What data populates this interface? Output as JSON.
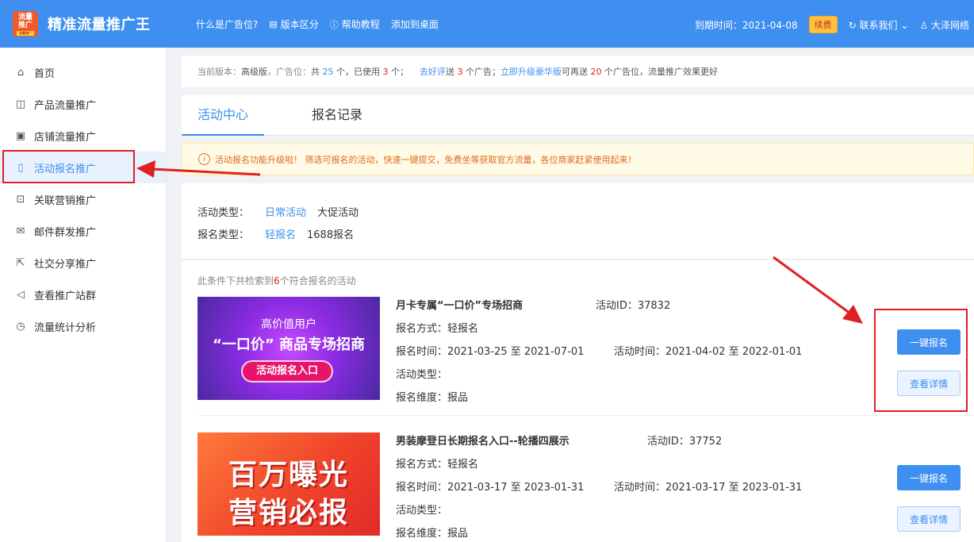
{
  "app": {
    "logo_line1": "流量",
    "logo_line2": "推广",
    "logo_sub": "流量推广",
    "title": "精准流量推广王"
  },
  "topnav": [
    {
      "label": "什么是广告位?",
      "icon": ""
    },
    {
      "label": "版本区分",
      "icon": "document-icon"
    },
    {
      "label": "帮助教程",
      "icon": "help-icon"
    },
    {
      "label": "添加到桌面",
      "icon": ""
    }
  ],
  "header_right": {
    "expire": "到期时间：2021-04-08",
    "renew": "续费",
    "contact": "联系我们",
    "user": "大泽网络"
  },
  "sidebar": [
    {
      "label": "首页",
      "icon": "home-icon"
    },
    {
      "label": "产品流量推广",
      "icon": "bag-icon"
    },
    {
      "label": "店铺流量推广",
      "icon": "store-icon"
    },
    {
      "label": "活动报名推广",
      "icon": "phone-icon"
    },
    {
      "label": "关联营销推广",
      "icon": "chart-icon"
    },
    {
      "label": "邮件群发推广",
      "icon": "mail-icon"
    },
    {
      "label": "社交分享推广",
      "icon": "share-icon"
    },
    {
      "label": "查看推广站群",
      "icon": "megaphone-icon"
    },
    {
      "label": "流量统计分析",
      "icon": "stats-icon"
    }
  ],
  "notice": {
    "p1": "当前版本：",
    "version": "高级版",
    "p2": "，广告位：",
    "p3": "共",
    "total": "25",
    "p4": "个，已使用",
    "used": "3",
    "p5": "个；",
    "review_link": "去好评",
    "p6": "送",
    "review_count": "3",
    "p7": "个广告；",
    "upgrade_link": "立即升级豪华版",
    "p8": "可再送",
    "upgrade_count": "20",
    "p9": "个广告位，流量推广效果更好"
  },
  "tabs": [
    "活动中心",
    "报名记录"
  ],
  "alert": "活动报名功能升级啦！ 筛选可报名的活动，快速一键提交，免费坐等获取官方流量，各位商家赶紧使用起来！",
  "filters": {
    "activity_type_label": "活动类型：",
    "activity_types": [
      "日常活动",
      "大促活动"
    ],
    "signup_type_label": "报名类型：",
    "signup_types": [
      "轻报名",
      "1688报名"
    ]
  },
  "results": {
    "prefix": "此条件下共检索到",
    "count": "6",
    "suffix": "个符合报名的活动"
  },
  "labels": {
    "id": "活动ID：",
    "mode": "报名方式：",
    "signup_time": "报名时间：",
    "activity_time": "活动时间：",
    "type": "活动类型：",
    "dimension": "报名维度：",
    "to": "至"
  },
  "cards": [
    {
      "title": "月卡专属“一口价”专场招商",
      "id": "37832",
      "mode": "轻报名",
      "signup_start": "2021-03-25",
      "signup_end": "2021-07-01",
      "act_start": "2021-04-02",
      "act_end": "2022-01-01",
      "type": "",
      "dimension": "报品",
      "banner": {
        "line1": "高价值用户",
        "line2": "“一口价” 商品专场招商",
        "btn": "活动报名入口"
      },
      "primary_btn": "一键报名",
      "detail_btn": "查看详情"
    },
    {
      "title": "男装摩登日长期报名入口--轮播四展示",
      "id": "37752",
      "mode": "轻报名",
      "signup_start": "2021-03-17",
      "signup_end": "2023-01-31",
      "act_start": "2021-03-17",
      "act_end": "2023-01-31",
      "type": "",
      "dimension": "报品",
      "banner": {
        "line1": "百万曝光",
        "line2": "营销必报"
      },
      "primary_btn": "一键报名",
      "detail_btn": "查看详情"
    }
  ]
}
